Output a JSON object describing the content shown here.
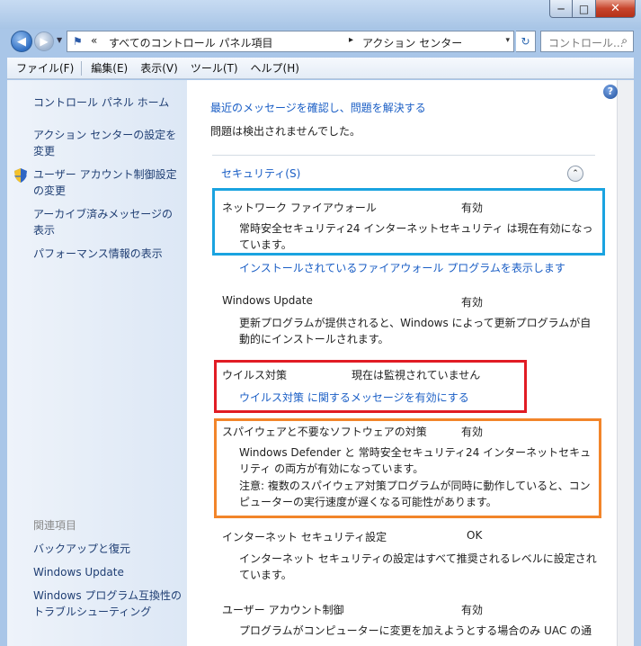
{
  "window": {
    "min_symbol": "─",
    "max_symbol": "□",
    "close_symbol": "✕"
  },
  "address": {
    "chevron": "«",
    "crumb_root": "すべてのコントロール パネル項目",
    "separator": "▸",
    "crumb_current": "アクション センター",
    "dropdown": "▾",
    "refresh": "↻"
  },
  "search": {
    "placeholder": "コントロール...",
    "icon": "⌕"
  },
  "menu": {
    "file": "ファイル(F)",
    "edit": "編集(E)",
    "view": "表示(V)",
    "tools": "ツール(T)",
    "help": "ヘルプ(H)"
  },
  "sidebar": {
    "home": "コントロール パネル ホーム",
    "action_settings": "アクション センターの設定を変更",
    "uac_settings": "ユーザー アカウント制御設定の変更",
    "archived": "アーカイブ済みメッセージの表示",
    "performance": "パフォーマンス情報の表示",
    "related_title": "関連項目",
    "backup": "バックアップと復元",
    "windows_update": "Windows Update",
    "compat": "Windows プログラム互換性のトラブルシューティング"
  },
  "main": {
    "header_link": "最近のメッセージを確認し、問題を解決する",
    "no_problems": "問題は検出されませんでした。",
    "security_title": "セキュリティ(S)",
    "collapse_symbol": "⌃",
    "firewall": {
      "name": "ネットワーク ファイアウォール",
      "status": "有効",
      "desc": "常時安全セキュリティ24 インターネットセキュリティ は現在有効になっています。",
      "link": "インストールされているファイアウォール プログラムを表示します"
    },
    "update": {
      "name": "Windows Update",
      "status": "有効",
      "desc": "更新プログラムが提供されると、Windows によって更新プログラムが自動的にインストールされます。"
    },
    "virus": {
      "name": "ウイルス対策",
      "status": "現在は監視されていません",
      "link": "ウイルス対策 に関するメッセージを有効にする"
    },
    "spyware": {
      "name": "スパイウェアと不要なソフトウェアの対策",
      "status": "有効",
      "desc1": "Windows Defender と 常時安全セキュリティ24 インターネットセキュリティ の両方が有効になっています。",
      "desc2": "注意: 複数のスパイウェア対策プログラムが同時に動作していると、コンピューターの実行速度が遅くなる可能性があります。"
    },
    "internet": {
      "name": "インターネット セキュリティ設定",
      "status": "OK",
      "desc": "インターネット セキュリティの設定はすべて推奨されるレベルに設定されています。"
    },
    "uac": {
      "name": "ユーザー アカウント制御",
      "status": "有効",
      "desc": "プログラムがコンピューターに変更を加えようとする場合のみ UAC の通"
    }
  },
  "help_symbol": "?"
}
